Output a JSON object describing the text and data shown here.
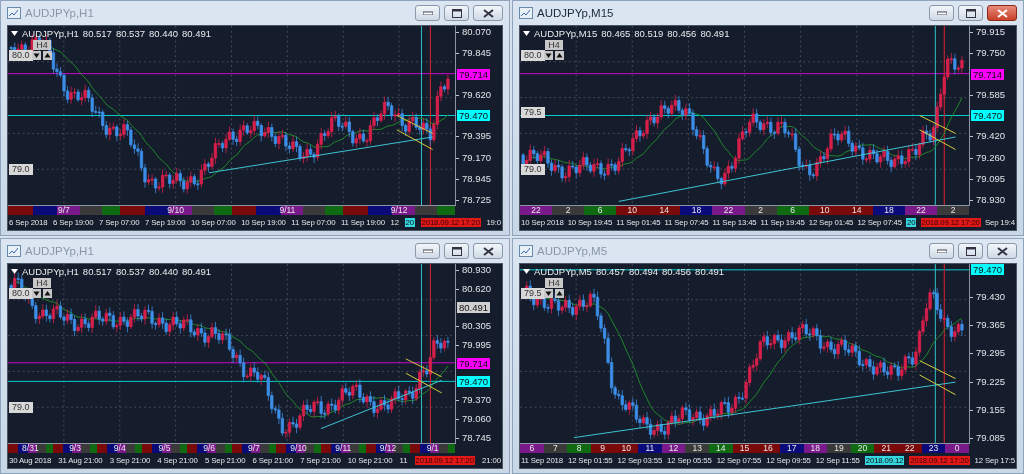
{
  "windows": [
    {
      "title": "AUDJPYp,H1",
      "active": false,
      "symbol": "AUDJPYp,H1",
      "ohlc": [
        "80.517",
        "80.537",
        "80.440",
        "80.491"
      ],
      "timeframe_tag": "H4",
      "level_labels": [
        "80.0",
        "79.0"
      ],
      "price_axis": [
        {
          "kind": "tick",
          "text": "80.070"
        },
        {
          "kind": "tick",
          "text": "79.845"
        },
        {
          "kind": "tag",
          "text": "79.714",
          "color": "#ff00ff"
        },
        {
          "kind": "tick",
          "text": "79.620"
        },
        {
          "kind": "tag",
          "text": "79.470",
          "color": "#00ffff"
        },
        {
          "kind": "tick",
          "text": "79.395"
        },
        {
          "kind": "tick",
          "text": "79.170"
        },
        {
          "kind": "tick",
          "text": "78.945"
        },
        {
          "kind": "tick",
          "text": "78.725"
        }
      ],
      "sessions": [
        "9/7",
        "9/10",
        "9/11",
        "9/12"
      ],
      "time_axis": [
        {
          "kind": "label",
          "text": "6 Sep 2018"
        },
        {
          "kind": "label",
          "text": "6 Sep 19:00"
        },
        {
          "kind": "label",
          "text": "7 Sep 07:00"
        },
        {
          "kind": "label",
          "text": "7 Sep 19:00"
        },
        {
          "kind": "label",
          "text": "10 Sep 07:00"
        },
        {
          "kind": "label",
          "text": "10 Sep 19:00"
        },
        {
          "kind": "label",
          "text": "11 Sep 07:00"
        },
        {
          "kind": "label",
          "text": "11 Sep 19:00"
        },
        {
          "kind": "label",
          "text": "12"
        },
        {
          "kind": "cursor",
          "text": "20"
        },
        {
          "kind": "marker",
          "text": "2018.09.12 17:20"
        },
        {
          "kind": "label",
          "text": "19:0"
        }
      ]
    },
    {
      "title": "AUDJPYp,M15",
      "active": true,
      "symbol": "AUDJPYp,M15",
      "ohlc": [
        "80.465",
        "80.519",
        "80.456",
        "80.491"
      ],
      "timeframe_tag": "H4",
      "level_labels": [
        "80.0",
        "79.5",
        "79.0"
      ],
      "price_axis": [
        {
          "kind": "tick",
          "text": "79.915"
        },
        {
          "kind": "tick",
          "text": "79.750"
        },
        {
          "kind": "tag",
          "text": "79.714",
          "color": "#ff00ff"
        },
        {
          "kind": "tick",
          "text": "79.585"
        },
        {
          "kind": "tag",
          "text": "79.470",
          "color": "#00ffff"
        },
        {
          "kind": "tick",
          "text": "79.420"
        },
        {
          "kind": "tick",
          "text": "79.260"
        },
        {
          "kind": "tick",
          "text": "79.095"
        },
        {
          "kind": "tick",
          "text": "78.930"
        }
      ],
      "sessions": [
        "22",
        "2",
        "6",
        "10",
        "14",
        "18",
        "22",
        "2",
        "6",
        "10",
        "14",
        "18",
        "22",
        "2"
      ],
      "time_axis": [
        {
          "kind": "label",
          "text": "10 Sep 2018"
        },
        {
          "kind": "label",
          "text": "10 Sep 19:45"
        },
        {
          "kind": "label",
          "text": "11 Sep 01:45"
        },
        {
          "kind": "label",
          "text": "11 Sep 07:45"
        },
        {
          "kind": "label",
          "text": "11 Sep 13:45"
        },
        {
          "kind": "label",
          "text": "11 Sep 19:45"
        },
        {
          "kind": "label",
          "text": "12 Sep 01:45"
        },
        {
          "kind": "label",
          "text": "12 Sep 07:45"
        },
        {
          "kind": "cursor",
          "text": "20"
        },
        {
          "kind": "marker",
          "text": "2018.09.12 17:20"
        },
        {
          "kind": "label",
          "text": "Sep 19:4"
        }
      ]
    },
    {
      "title": "AUDJPYp,H1",
      "active": false,
      "symbol": "AUDJPYp,H1",
      "ohlc": [
        "80.517",
        "80.537",
        "80.440",
        "80.491"
      ],
      "timeframe_tag": "H4",
      "level_labels": [
        "80.0",
        "79.0"
      ],
      "price_axis": [
        {
          "kind": "tick",
          "text": "80.930"
        },
        {
          "kind": "tick",
          "text": "80.620"
        },
        {
          "kind": "tag",
          "text": "80.491",
          "color": "#d0d0d0"
        },
        {
          "kind": "tick",
          "text": "80.305"
        },
        {
          "kind": "tick",
          "text": "79.995"
        },
        {
          "kind": "tag",
          "text": "79.714",
          "color": "#ff00ff"
        },
        {
          "kind": "tag",
          "text": "79.470",
          "color": "#00ffff"
        },
        {
          "kind": "tick",
          "text": "79.370"
        },
        {
          "kind": "tick",
          "text": "79.060"
        },
        {
          "kind": "tick",
          "text": "78.745"
        }
      ],
      "sessions": [
        "8/31",
        "9/3",
        "9/4",
        "9/5",
        "9/6",
        "9/7",
        "9/10",
        "9/11",
        "9/12",
        "9/1"
      ],
      "time_axis": [
        {
          "kind": "label",
          "text": "30 Aug 2018"
        },
        {
          "kind": "label",
          "text": "31 Aug 21:00"
        },
        {
          "kind": "label",
          "text": "3 Sep 21:00"
        },
        {
          "kind": "label",
          "text": "4 Sep 21:00"
        },
        {
          "kind": "label",
          "text": "5 Sep 21:00"
        },
        {
          "kind": "label",
          "text": "6 Sep 21:00"
        },
        {
          "kind": "label",
          "text": "7 Sep 21:00"
        },
        {
          "kind": "label",
          "text": "10 Sep 21:00"
        },
        {
          "kind": "label",
          "text": "11"
        },
        {
          "kind": "marker",
          "text": "2018.09.12 17:20"
        },
        {
          "kind": "label",
          "text": "21:00"
        }
      ]
    },
    {
      "title": "AUDJPYp,M5",
      "active": false,
      "symbol": "AUDJPYp,M5",
      "ohlc": [
        "80.457",
        "80.494",
        "80.456",
        "80.491"
      ],
      "timeframe_tag": "H4",
      "level_labels": [
        "79.5"
      ],
      "price_axis": [
        {
          "kind": "tag",
          "text": "79.470",
          "color": "#00ffff"
        },
        {
          "kind": "tick",
          "text": "79.430"
        },
        {
          "kind": "tick",
          "text": "79.365"
        },
        {
          "kind": "tick",
          "text": "79.295"
        },
        {
          "kind": "tick",
          "text": "79.225"
        },
        {
          "kind": "tick",
          "text": "79.155"
        },
        {
          "kind": "tick",
          "text": "79.085"
        }
      ],
      "sessions": [
        "6",
        "7",
        "8",
        "9",
        "10",
        "11",
        "12",
        "13",
        "14",
        "15",
        "16",
        "17",
        "18",
        "19",
        "20",
        "21",
        "22",
        "23",
        "0"
      ],
      "time_axis": [
        {
          "kind": "label",
          "text": "11 Sep 2018"
        },
        {
          "kind": "label",
          "text": "12 Sep 01:55"
        },
        {
          "kind": "label",
          "text": "12 Sep 03:55"
        },
        {
          "kind": "label",
          "text": "12 Sep 05:55"
        },
        {
          "kind": "label",
          "text": "12 Sep 07:55"
        },
        {
          "kind": "label",
          "text": "12 Sep 09:55"
        },
        {
          "kind": "label",
          "text": "12 Sep 11:55"
        },
        {
          "kind": "cursor",
          "text": "2018.09.12"
        },
        {
          "kind": "marker",
          "text": "2018.09.12 17:20"
        },
        {
          "kind": "label",
          "text": "12 Sep 17:5"
        }
      ]
    }
  ]
}
